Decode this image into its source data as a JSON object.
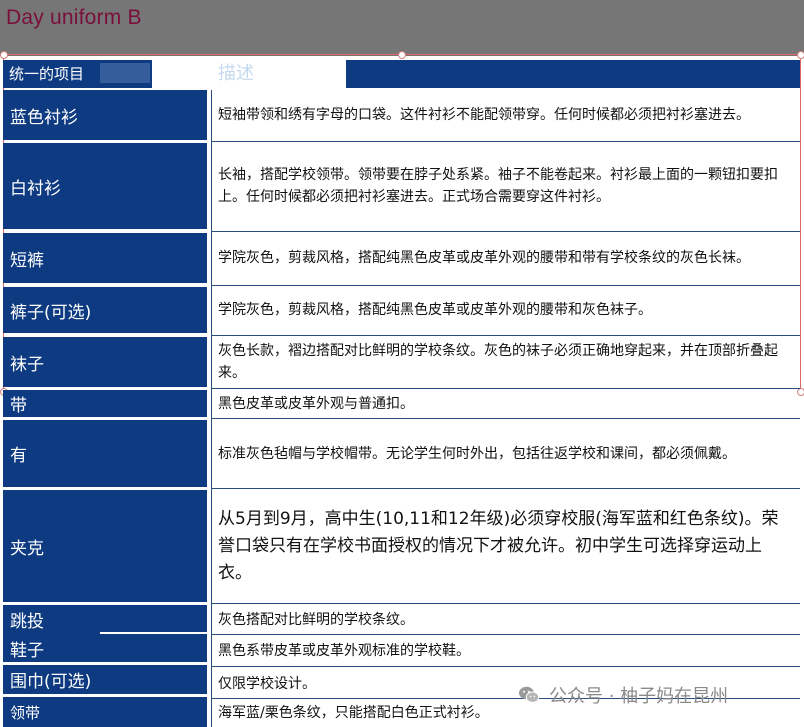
{
  "page_title": "Day uniform B",
  "header": {
    "item_label": "统一的项目",
    "desc_label": "描述"
  },
  "rows": [
    {
      "item": "蓝色衬衫",
      "desc": "短袖带领和绣有字母的口袋。这件衬衫不能配领带穿。任何时候都必须把衬衫塞进去。"
    },
    {
      "item": "白衬衫",
      "desc": "长袖，搭配学校领带。领带要在脖子处系紧。袖子不能卷起来。衬衫最上面的一颗钮扣要扣上。任何时候都必须把衬衫塞进去。正式场合需要穿这件衬衫。"
    },
    {
      "item": "短裤",
      "desc": "学院灰色，剪裁风格，搭配纯黑色皮革或皮革外观的腰带和带有学校条纹的灰色长袜。"
    },
    {
      "item": "裤子(可选)",
      "desc": "学院灰色，剪裁风格，搭配纯黑色皮革或皮革外观的腰带和灰色袜子。"
    },
    {
      "item": "袜子",
      "desc": "灰色长款，褶边搭配对比鲜明的学校条纹。灰色的袜子必须正确地穿起来，并在顶部折叠起来。"
    },
    {
      "item": "带",
      "desc": "黑色皮革或皮革外观与普通扣。"
    },
    {
      "item": "有",
      "desc": "标准灰色毡帽与学校帽带。无论学生何时外出，包括往返学校和课间，都必须佩戴。"
    },
    {
      "item": "夹克",
      "desc": "从5月到9月，高中生(10,11和12年级)必须穿校服(海军蓝和红色条纹)。荣誉口袋只有在学校书面授权的情况下才被允许。初中学生可选择穿运动上衣。"
    },
    {
      "item": "跳投",
      "desc": "灰色搭配对比鲜明的学校条纹。"
    },
    {
      "item": "鞋子",
      "desc": "黑色系带皮革或皮革外观标准的学校鞋。"
    },
    {
      "item": "围巾(可选)",
      "desc": "仅限学校设计。"
    },
    {
      "item": "领带",
      "desc": "海军蓝/栗色条纹，只能搭配白色正式衬衫。"
    }
  ],
  "watermark": {
    "text": "公众号 · 柚子妈在昆州",
    "icon": "wechat-icon"
  },
  "colors": {
    "navy": "#0d3a80",
    "title": "#7a0f3a",
    "topbar": "#767676"
  }
}
